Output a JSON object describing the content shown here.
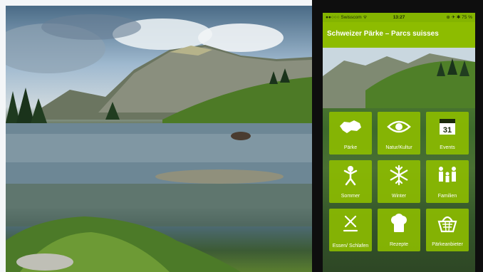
{
  "phone": {
    "status": {
      "carrier": "●●○○○ Swisscom ᯤ",
      "time": "13:27",
      "battery": "⊕ ✈ ✱ 75 %"
    },
    "app_title": "Schweizer Pärke – Parcs suisses",
    "tiles": [
      {
        "label": "Pärke",
        "icon": "switzerland-map-icon"
      },
      {
        "label": "Natur/Kultur",
        "icon": "eye-icon"
      },
      {
        "label": "Events",
        "icon": "calendar-icon",
        "calendar_day": "31"
      },
      {
        "label": "Sommer",
        "icon": "summer-sun-person-icon"
      },
      {
        "label": "Winter",
        "icon": "snowflake-icon"
      },
      {
        "label": "Familien",
        "icon": "family-icon"
      },
      {
        "label": "Essen/ Schlafen",
        "icon": "cutlery-bed-icon"
      },
      {
        "label": "Rezepte",
        "icon": "chef-hat-icon"
      },
      {
        "label": "Pärkeanbieter",
        "icon": "basket-icon"
      }
    ],
    "accent_color": "#8dbc00"
  }
}
